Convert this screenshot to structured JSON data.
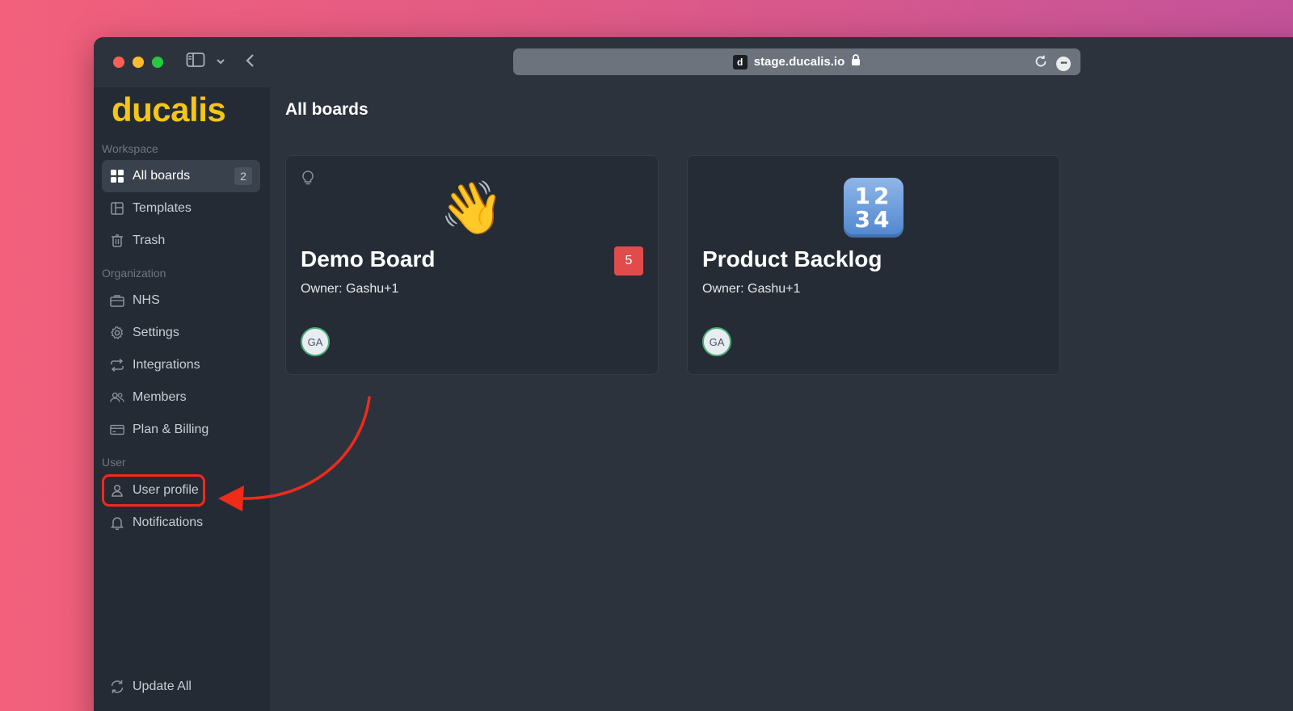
{
  "browser": {
    "url": "stage.ducalis.io",
    "favicon_letter": "d"
  },
  "sidebar": {
    "logo": "ducalis",
    "sections": {
      "workspace": "Workspace",
      "organization": "Organization",
      "user": "User"
    },
    "workspace_items": [
      {
        "label": "All boards",
        "icon": "grid-icon",
        "badge": "2",
        "active": true
      },
      {
        "label": "Templates",
        "icon": "template-icon"
      },
      {
        "label": "Trash",
        "icon": "trash-icon"
      }
    ],
    "organization_items": [
      {
        "label": "NHS",
        "icon": "briefcase-icon"
      },
      {
        "label": "Settings",
        "icon": "gear-icon"
      },
      {
        "label": "Integrations",
        "icon": "sync-icon"
      },
      {
        "label": "Members",
        "icon": "users-icon"
      },
      {
        "label": "Plan & Billing",
        "icon": "credit-card-icon"
      }
    ],
    "user_items": [
      {
        "label": "User profile",
        "icon": "user-icon",
        "highlighted": true
      },
      {
        "label": "Notifications",
        "icon": "bell-icon"
      }
    ],
    "footer_item": {
      "label": "Update All",
      "icon": "refresh-icon"
    }
  },
  "main": {
    "title": "All boards",
    "boards": [
      {
        "name": "Demo Board",
        "emoji": "👋",
        "owner": "Owner: Gashu+1",
        "avatar": "GA",
        "badge": "5"
      },
      {
        "name": "Product Backlog",
        "emoji_top": "12",
        "emoji_bottom": "34",
        "owner": "Owner: Gashu+1",
        "avatar": "GA"
      }
    ]
  },
  "colors": {
    "accent": "#f5c518",
    "annotation": "#ef2b1a",
    "badge_red": "#e24b4b"
  }
}
